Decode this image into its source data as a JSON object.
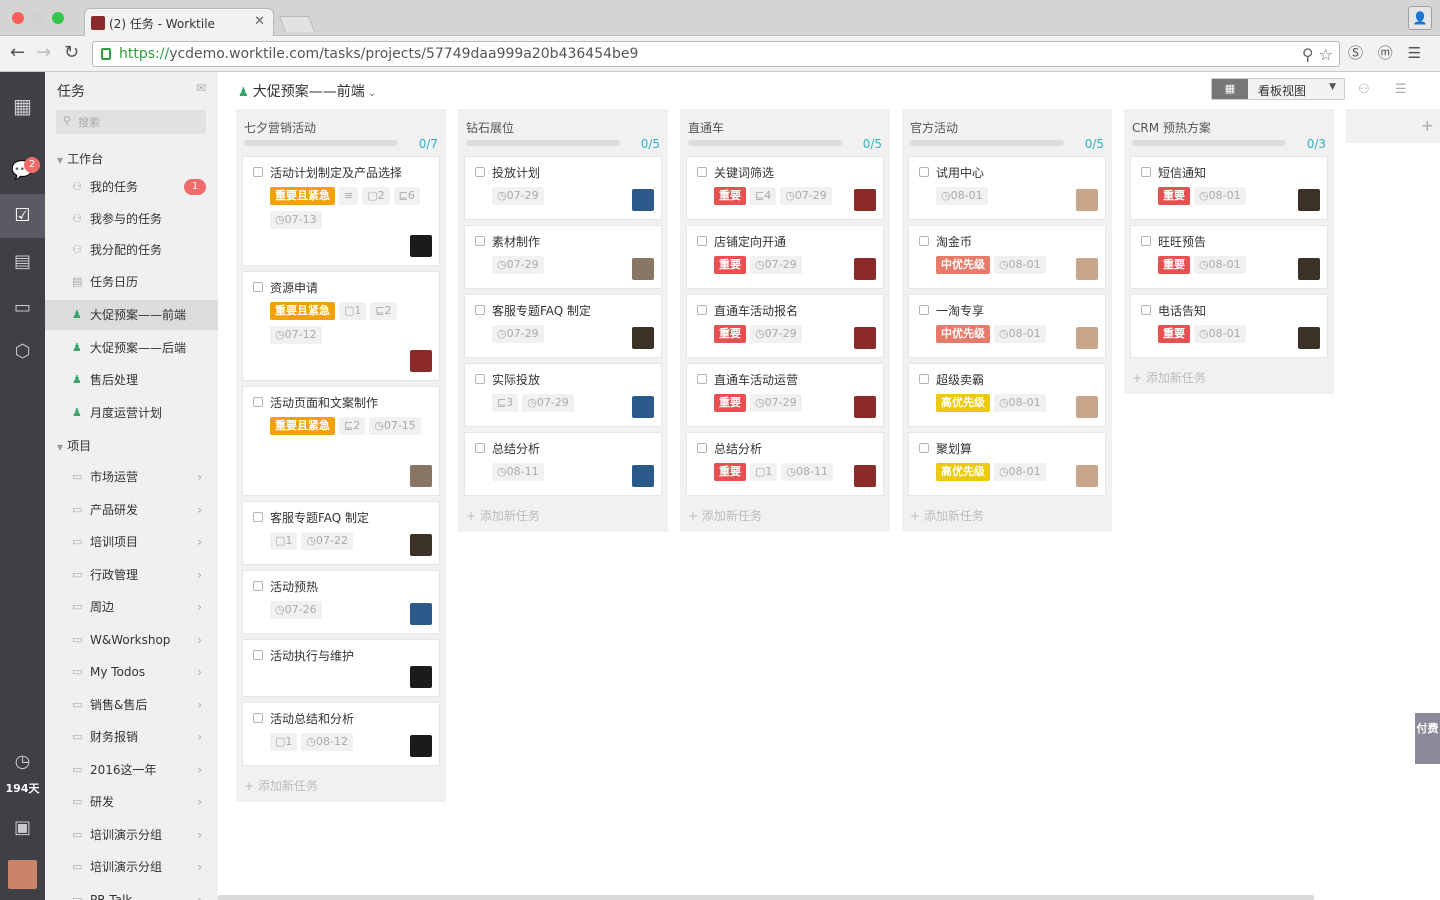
{
  "browser": {
    "tab_title": "(2) 任务 - Worktile",
    "url_scheme": "https://",
    "url_rest": "ycdemo.worktile.com/tasks/projects/57749daa999a20b436454be9"
  },
  "rail": {
    "chat_badge": "2",
    "days": "194天"
  },
  "sidebar": {
    "title": "任务",
    "search_placeholder": "搜索",
    "workbench_label": "工作台",
    "my_tasks": "我的任务",
    "my_tasks_count": "1",
    "joined_tasks": "我参与的任务",
    "assigned_tasks": "我分配的任务",
    "calendar": "任务日历",
    "pinned_projects": [
      "大促预案——前端",
      "大促预案——后端",
      "售后处理",
      "月度运营计划"
    ],
    "projects_label": "项目",
    "folders": [
      "市场运营",
      "产品研发",
      "培训项目",
      "行政管理",
      "周边",
      "W&Workshop",
      "My Todos",
      "销售&售后",
      "财务报销",
      "2016这一年",
      "研发",
      "培训演示分组",
      "培训演示分组",
      "PR Talk"
    ]
  },
  "main": {
    "project_title": "大促预案——前端",
    "view_label": "看板视图",
    "add_task": "添加新任务",
    "pay_label": "付费",
    "columns": [
      {
        "title": "七夕营销活动",
        "progress": "0/7",
        "cards": [
          {
            "text": "活动计划制定及产品选择",
            "tag": "重要且紧急",
            "tagc": "orange",
            "desc": "",
            "comments": "2",
            "subtasks": "6",
            "date": "07-13",
            "av": "a6"
          },
          {
            "text": "资源申请",
            "tag": "重要且紧急",
            "tagc": "orange",
            "comments": "1",
            "subtasks": "2",
            "date": "07-12",
            "av": "a4"
          },
          {
            "text": "活动页面和文案制作",
            "tag": "重要且紧急",
            "tagc": "orange",
            "subtasks": "2",
            "date": "07-15",
            "av": "a2"
          },
          {
            "text": "客服专题FAQ 制定",
            "comments": "1",
            "date": "07-22",
            "av": "a3"
          },
          {
            "text": "活动预热",
            "date": "07-26",
            "av": "a1"
          },
          {
            "text": "活动执行与维护",
            "av": "a6"
          },
          {
            "text": "活动总结和分析",
            "comments": "1",
            "date": "08-12",
            "av": "a6"
          }
        ]
      },
      {
        "title": "钻石展位",
        "progress": "0/5",
        "cards": [
          {
            "text": "投放计划",
            "date": "07-29",
            "av": "a1"
          },
          {
            "text": "素材制作",
            "date": "07-29",
            "av": "a2"
          },
          {
            "text": "客服专题FAQ 制定",
            "date": "07-29",
            "av": "a3"
          },
          {
            "text": "实际投放",
            "subtasks": "3",
            "date": "07-29",
            "av": "a1"
          },
          {
            "text": "总结分析",
            "date": "08-11",
            "av": "a1"
          }
        ]
      },
      {
        "title": "直通车",
        "progress": "0/5",
        "cards": [
          {
            "text": "关键词筛选",
            "tag": "重要",
            "tagc": "red",
            "subtasks": "4",
            "date": "07-29",
            "av": "a4"
          },
          {
            "text": "店铺定向开通",
            "tag": "重要",
            "tagc": "red",
            "date": "07-29",
            "av": "a4"
          },
          {
            "text": "直通车活动报名",
            "tag": "重要",
            "tagc": "red",
            "date": "07-29",
            "av": "a4"
          },
          {
            "text": "直通车活动运营",
            "tag": "重要",
            "tagc": "red",
            "date": "07-29",
            "av": "a4"
          },
          {
            "text": "总结分析",
            "tag": "重要",
            "tagc": "red",
            "comments": "1",
            "date": "08-11",
            "av": "a4"
          }
        ]
      },
      {
        "title": "官方活动",
        "progress": "0/5",
        "cards": [
          {
            "text": "试用中心",
            "date": "08-01",
            "av": "a5"
          },
          {
            "text": "淘金币",
            "tag": "中优先级",
            "tagc": "salmon",
            "date": "08-01",
            "av": "a5"
          },
          {
            "text": "一淘专享",
            "tag": "中优先级",
            "tagc": "salmon",
            "date": "08-01",
            "av": "a5"
          },
          {
            "text": "超级卖霸",
            "tag": "高优先级",
            "tagc": "yellow",
            "date": "08-01",
            "av": "a5"
          },
          {
            "text": "聚划算",
            "tag": "高优先级",
            "tagc": "yellow",
            "date": "08-01",
            "av": "a5"
          }
        ]
      },
      {
        "title": "CRM 预热方案",
        "progress": "0/3",
        "cards": [
          {
            "text": "短信通知",
            "tag": "重要",
            "tagc": "red",
            "date": "08-01",
            "av": "a3"
          },
          {
            "text": "旺旺预告",
            "tag": "重要",
            "tagc": "red",
            "date": "08-01",
            "av": "a3"
          },
          {
            "text": "电话告知",
            "tag": "重要",
            "tagc": "red",
            "date": "08-01",
            "av": "a3"
          }
        ]
      }
    ]
  }
}
